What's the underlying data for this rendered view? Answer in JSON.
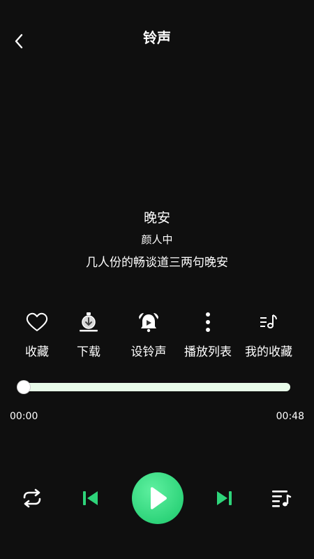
{
  "header": {
    "title": "铃声"
  },
  "song": {
    "title": "晚安",
    "artist": "颜人中",
    "lyric": "几人份的畅谈道三两句晚安"
  },
  "actions": [
    {
      "label": "收藏",
      "icon": "heart-icon"
    },
    {
      "label": "下载",
      "icon": "download-icon"
    },
    {
      "label": "设铃声",
      "icon": "alarm-icon"
    },
    {
      "label": "播放列表",
      "icon": "more-vertical-icon"
    },
    {
      "label": "我的收藏",
      "icon": "music-list-icon"
    }
  ],
  "player": {
    "current_time": "00:00",
    "total_time": "00:48",
    "progress": 0
  },
  "controls": {
    "repeat_icon": "repeat-icon",
    "prev_icon": "skip-previous-icon",
    "play_icon": "play-icon",
    "next_icon": "skip-next-icon",
    "playlist_icon": "playlist-icon"
  },
  "colors": {
    "background": "#0f0f0f",
    "accent": "#2ed47a",
    "progress_track": "#e8fbe9"
  }
}
